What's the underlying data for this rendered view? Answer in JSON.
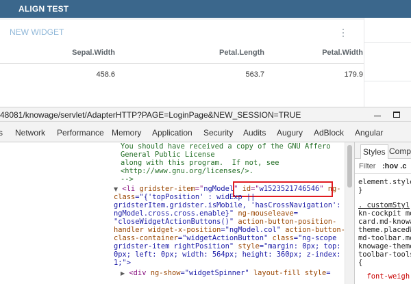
{
  "app": {
    "title": "ALIGN TEST"
  },
  "widget": {
    "title": "NEW WIDGET",
    "columns": [
      "Sepal.Width",
      "Petal.Length",
      "Petal.Width"
    ],
    "row": [
      "458.6",
      "563.7",
      "179.9"
    ]
  },
  "devtools": {
    "url": "48081/knowage/servlet/AdapterHTTP?PAGE=LoginPage&NEW_SESSION=TRUE",
    "tabs": [
      "Network",
      "Performance",
      "Memory",
      "Application",
      "Security",
      "Audits",
      "Augury",
      "AdBlock",
      "Angular"
    ],
    "comment_lines": [
      "You should have received a copy of the GNU Affero",
      "General Public License",
      "along with this program.  If not, see",
      "<http://www.gnu.org/licenses/>.",
      "-->"
    ],
    "li_line": {
      "open": "<li ",
      "attr1": "gridster-item",
      "eq1": "=\"",
      "val1": "ngModel",
      "close1": "\" ",
      "attr2": "id",
      "eq2": "=\"",
      "val2": "w1523521746546",
      "close2": "\" ",
      "attr3": "ng-"
    },
    "code_lines": [
      {
        "attr": "class",
        "val": "=\"{'topPosition' : widExp ||"
      },
      {
        "attr": "",
        "val": "gridsterItem.gridster.isMobile, 'hasCrossNavigation':"
      },
      {
        "attr": "",
        "val": "ngModel.cross.cross.enable}\" ",
        "attr_tail": "ng-mouseleave",
        "val_tail": "="
      },
      {
        "attr": "",
        "val": "\"closeWidgetActionButtons()\" ",
        "attr_tail": "action-button-position-",
        "val_tail": ""
      },
      {
        "attr": "handler widget-x-position",
        "val": "=\"ngModel.col\" ",
        "attr_tail": "action-button-",
        "val_tail": ""
      },
      {
        "attr": "class-container",
        "val": "=\"widgetActionButton\" ",
        "attr_tail": "class",
        "val_tail": "=\"ng-scope"
      },
      {
        "attr": "",
        "val": "gridster-item rightPosition\" ",
        "attr_tail": "style",
        "val_tail": "=\"margin: 0px; top:"
      },
      {
        "attr": "",
        "val": "0px; left: 0px; width: 564px; height: 360px; z-index:",
        "attr_tail": "",
        "val_tail": ""
      },
      {
        "attr": "",
        "val": "1;\">",
        "attr_tail": "",
        "val_tail": ""
      }
    ],
    "div_line": {
      "open": "<div ",
      "attr1": "ng-show",
      "val1": "=\"widgetSpinner\" ",
      "attr2": "layout-fill style",
      "val2": "="
    },
    "styles": {
      "tab_active": "Styles",
      "tab2": "Compu",
      "filter_label": "Filter",
      "filter_hov": ":hov .c",
      "lines": [
        "element.style",
        "}",
        ". customStyl",
        "kn-cockpit mo",
        "card.md-knowa",
        "theme.placedW",
        "md-toolbar.mo",
        "knowage-theme",
        "toolbar-tools",
        "{",
        "  font-weigh"
      ]
    }
  }
}
